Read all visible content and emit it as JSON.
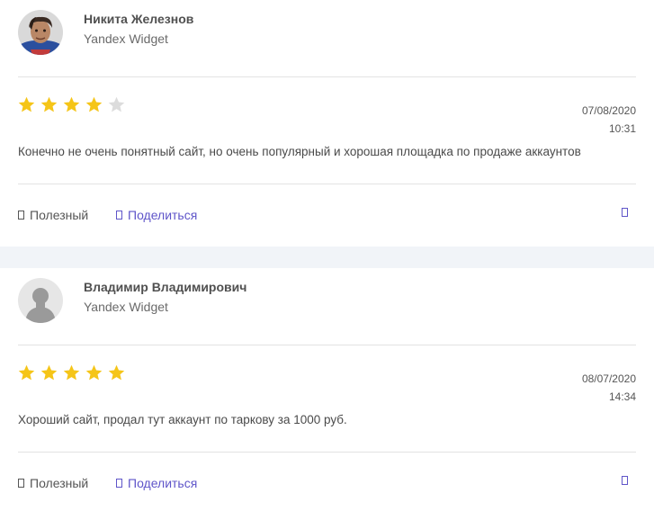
{
  "colors": {
    "star_filled": "#f5c518",
    "star_empty": "#dcdcdc",
    "link": "#5f55c9",
    "separator": "#f1f4f8"
  },
  "reviews": [
    {
      "author": "Никита Железнов",
      "source": "Yandex Widget",
      "rating": 4,
      "max_rating": 5,
      "date": "07/08/2020",
      "time": "10:31",
      "text": "Конечно не очень понятный сайт, но очень популярный и хорошая площадка по продаже аккаунтов",
      "avatar_icon": "user-photo",
      "actions": {
        "useful_label": "Полезный",
        "share_label": "Поделиться"
      }
    },
    {
      "author": "Владимир Владимирович",
      "source": "Yandex Widget",
      "rating": 5,
      "max_rating": 5,
      "date": "08/07/2020",
      "time": "14:34",
      "text": "Хороший сайт, продал тут аккаунт по таркову за 1000 руб.",
      "avatar_icon": "default-user-silhouette",
      "actions": {
        "useful_label": "Полезный",
        "share_label": "Поделиться"
      }
    }
  ]
}
